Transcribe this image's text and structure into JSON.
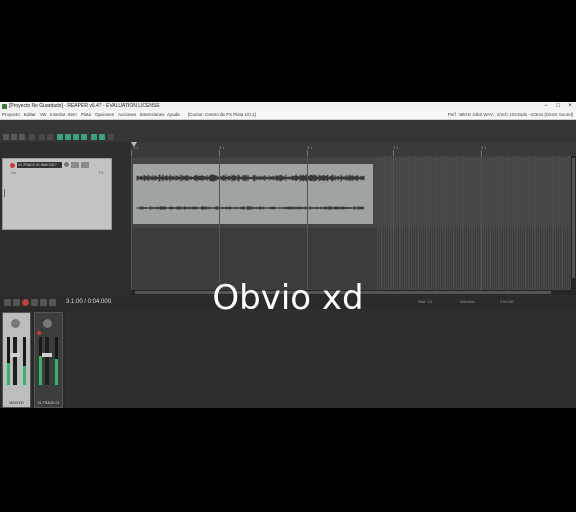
{
  "window": {
    "title": "[Proyecto No Guardado] - REAPER v6.47 - EVALUATION LICENSE",
    "minimize_label": "−",
    "maximize_label": "□",
    "close_label": "×"
  },
  "menu": {
    "items": [
      "Proyecto",
      "Editar",
      "Ver",
      "Insertar",
      "Item",
      "Pista",
      "Opciones",
      "Acciones",
      "Extensiones",
      "Ayuda"
    ],
    "marker": "[Cursor: Centro de FX Pista 1/0.1]",
    "status": "Perf. 48kHz 24bit WAV : 2/2ch 1024spls ~2/3ms [Direct Sound]"
  },
  "ruler": {
    "ticks": [
      "1.1",
      "3.1",
      "5.1",
      "7.1",
      "9.1"
    ],
    "subticks": [
      "0:00.000",
      "0:04.000",
      "0:08.000",
      "0:12.000",
      "0:16.000"
    ]
  },
  "track": {
    "name": "01-TRACK 01.WAV.2017",
    "vol_label": "Vol",
    "trim_label": "trim",
    "fx_label": "FX"
  },
  "transport": {
    "time": "3.1.00 / 0:04.000",
    "rate_label": "Rate: 1.0",
    "sel_label": "Selection:",
    "len_label": "0:00.000"
  },
  "mixer": {
    "master_label": "MASTER",
    "track_label": "01-TRACK 01",
    "master_level": 0.45,
    "track_level": 0.6
  },
  "caption": "Obvio xd",
  "colors": {
    "item_bg": "#a0a3a3",
    "wave": "#1e1e1e",
    "accent_green": "#3aa37a",
    "record_red": "#c43a3a"
  }
}
